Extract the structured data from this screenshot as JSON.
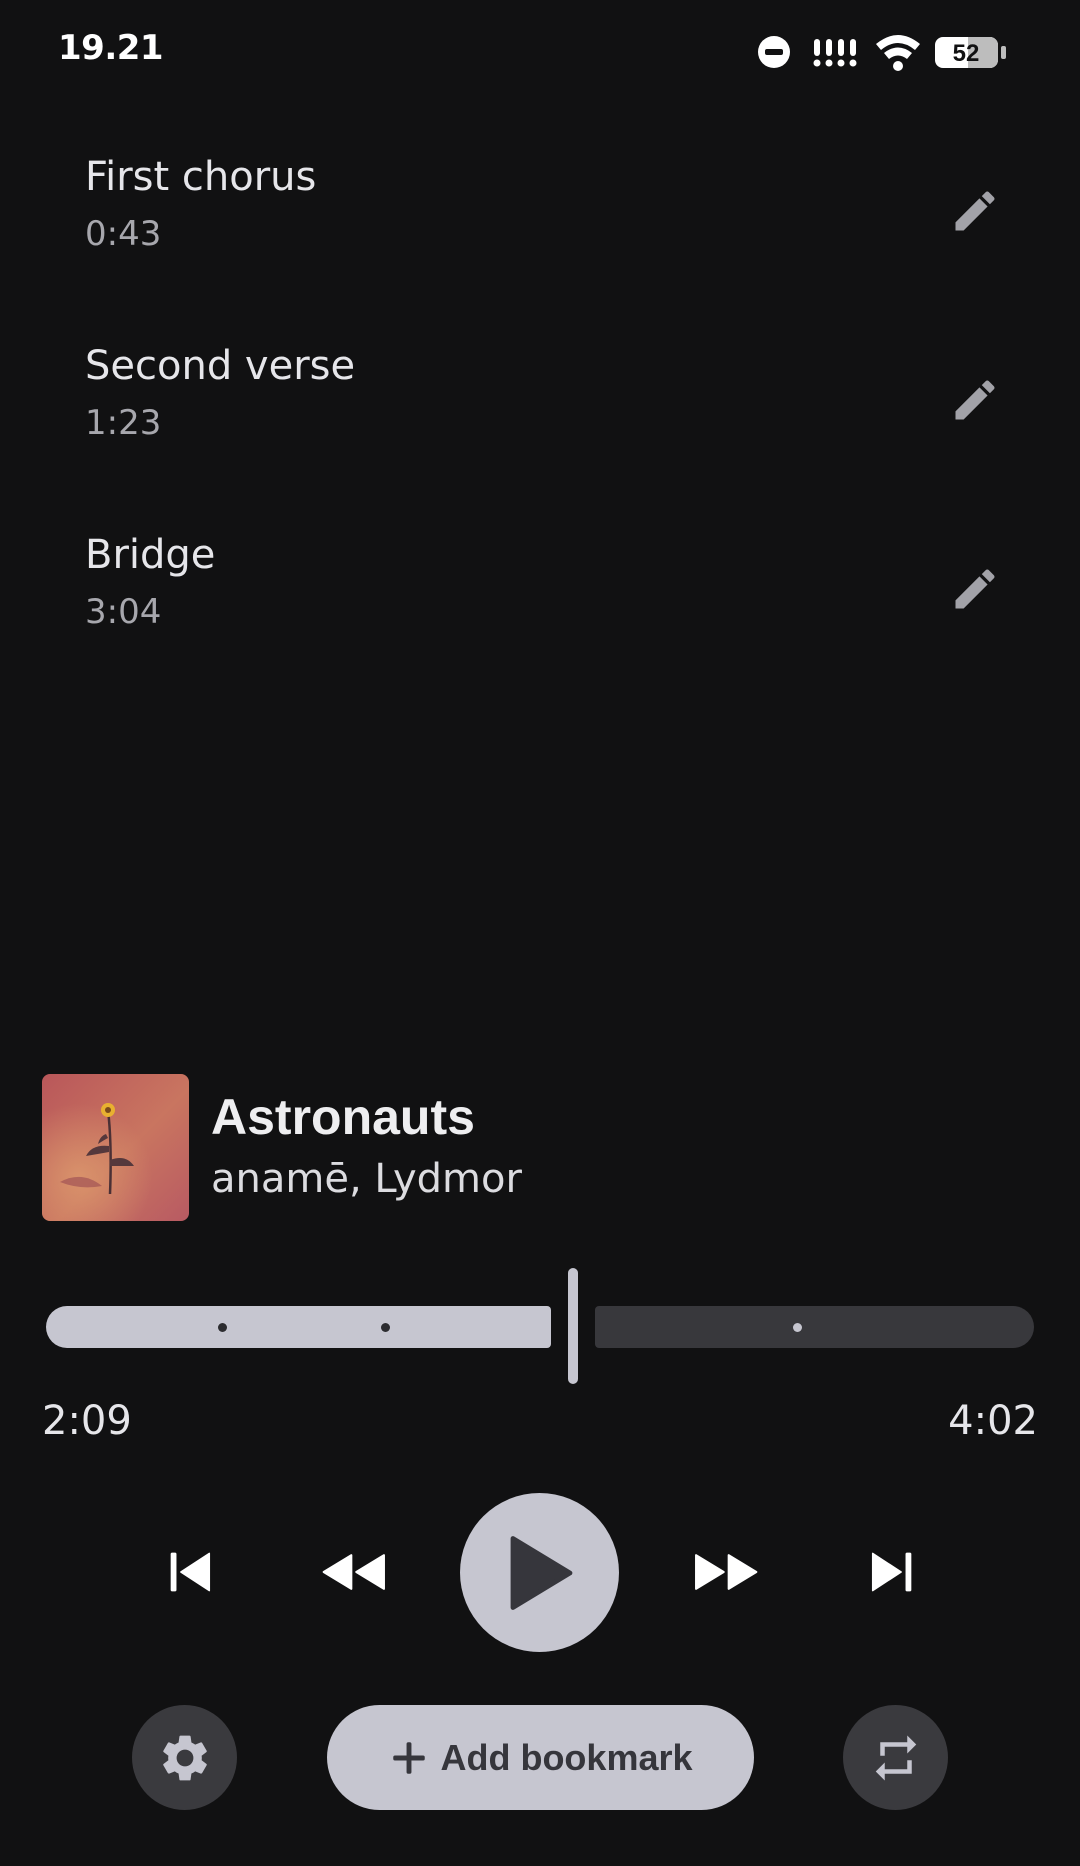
{
  "status_bar": {
    "time": "19.21",
    "battery": "52",
    "icons": [
      "do-not-disturb-icon",
      "signal-icon",
      "wifi-icon",
      "battery-icon"
    ]
  },
  "bookmarks": [
    {
      "title": "First chorus",
      "time": "0:43"
    },
    {
      "title": "Second verse",
      "time": "1:23"
    },
    {
      "title": "Bridge",
      "time": "3:04"
    }
  ],
  "now_playing": {
    "title": "Astronauts",
    "artist": "anamē, Lydmor"
  },
  "playback": {
    "elapsed": "2:09",
    "total": "4:02",
    "progress_fraction": 0.533
  },
  "actions": {
    "add_bookmark_label": "Add bookmark"
  },
  "colors": {
    "background": "#111112",
    "accent": "#c6c6d0",
    "track_remaining": "#38383c",
    "button_dark": "#3a3a3e"
  }
}
